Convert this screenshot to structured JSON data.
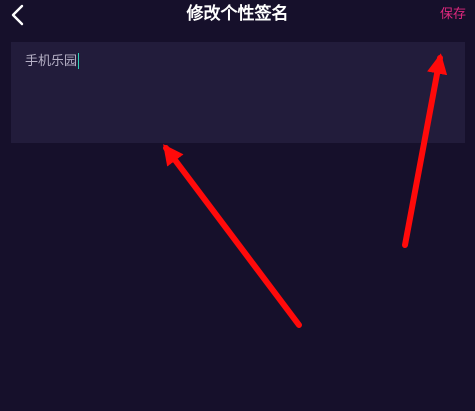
{
  "header": {
    "back_icon": "chevron-left-icon",
    "title": "修改个性签名",
    "save_label": "保存",
    "save_color": "#e0287e"
  },
  "signature": {
    "value": "手机乐园",
    "cursor_color": "#2ed1b7"
  },
  "colors": {
    "background": "#16102b",
    "input_background": "#221c3b",
    "annotation_arrow": "#ff0a0a"
  }
}
